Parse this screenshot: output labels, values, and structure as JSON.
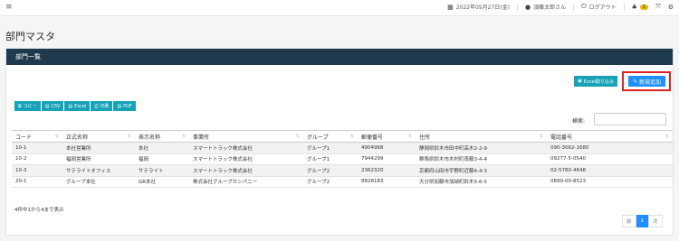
{
  "topbar": {
    "date": "2022年05月27日(金)",
    "user": "須藤太郎さん",
    "logout": "ログアウト",
    "notif_count": "1"
  },
  "page_title": "部門マスタ",
  "panel": {
    "title": "部門一覧",
    "excel_import": "Excel取り込み",
    "new_button": "新規追加",
    "export": {
      "copy": "コピー",
      "csv": "CSV",
      "excel": "Excel",
      "print": "印刷",
      "pdf": "PDF"
    },
    "search_label": "検索:",
    "search_value": "",
    "columns": [
      "コード",
      "正式名称",
      "表示名称",
      "事業所",
      "グループ",
      "郵便番号",
      "住所",
      "電話番号"
    ],
    "rows": [
      [
        "10-1",
        "本社営業所",
        "本社",
        "スマートトラック株式会社",
        "グループ1",
        "4904968",
        "静岡県鈴木市田中町高木2-2-9",
        "090-3062-1680"
      ],
      [
        "10-2",
        "福岡営業所",
        "福岡",
        "スマートトラック株式会社",
        "グループ1",
        "7944299",
        "群馬県鈴木市木村町斎藤3-4-4",
        "09277-5-0540"
      ],
      [
        "10-3",
        "サテライトオフィス",
        "サテライト",
        "スマートトラック株式会社",
        "グループ2",
        "2362320",
        "京都府山田市宇野町近藤4-4-3",
        "02-5780-4648"
      ],
      [
        "20-1",
        "グループ本社",
        "GR本社",
        "株式会社グループカンパニー",
        "グループ2",
        "8828183",
        "大分県加藤市加納町鈴木5-6-5",
        "0899-00-8523"
      ]
    ],
    "info": "4件中1から4まで表示",
    "pager": {
      "prev": "前",
      "current": "1",
      "next": "次"
    }
  }
}
